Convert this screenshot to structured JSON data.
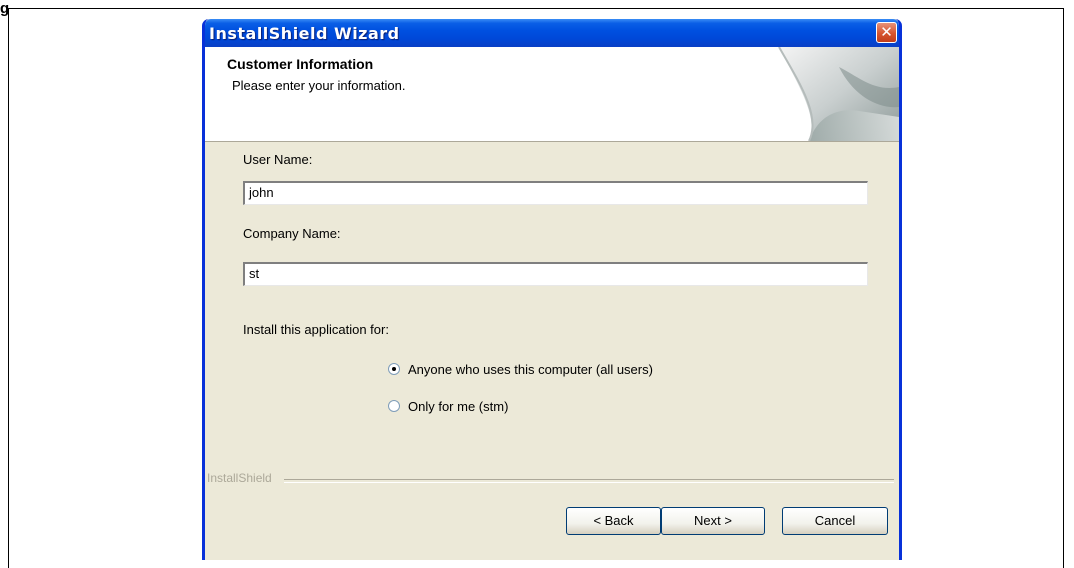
{
  "figure": {
    "tag": "g"
  },
  "window": {
    "title": "InstallShield Wizard",
    "close_glyph": "✕"
  },
  "header": {
    "title": "Customer Information",
    "subtitle": "Please enter your information.",
    "art_icon": "page-curl-icon"
  },
  "form": {
    "user_name_label": "User Name:",
    "user_name_value": "john",
    "company_label": "Company Name:",
    "company_value": "st",
    "install_for_label": "Install this application for:",
    "options": [
      {
        "label": "Anyone who uses this computer (all users)",
        "selected": true
      },
      {
        "label": "Only for me (stm)",
        "selected": false
      }
    ]
  },
  "footer": {
    "brand": "InstallShield",
    "back_label": "< Back",
    "next_label": "Next >",
    "cancel_label": "Cancel"
  },
  "colors": {
    "titlebar": "#0050e0",
    "dialog_bg": "#ece9d8",
    "close_button": "#d6552f"
  }
}
